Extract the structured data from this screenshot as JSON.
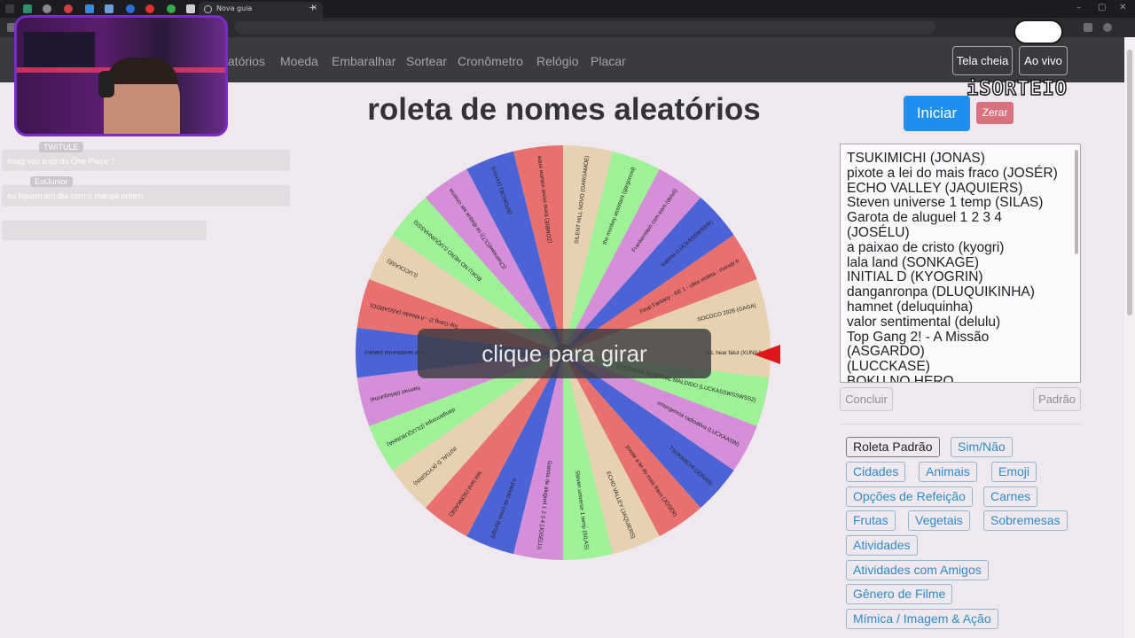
{
  "browser": {
    "tab_title": "Nova guia",
    "new_tab_symbol": "+",
    "close_symbol": "×",
    "window_controls": [
      "–",
      "▢",
      "✕"
    ]
  },
  "nav": {
    "items": [
      "leatórios",
      "Moeda",
      "Embaralhar",
      "Sortear",
      "Cronômetro",
      "Relógio",
      "Placar"
    ],
    "fullscreen_label": "Tela cheia",
    "live_label": "Ao vivo"
  },
  "page": {
    "title": "roleta de nomes aleatórios",
    "start_label": "Iniciar",
    "clear_label": "Zerar",
    "spin_overlay": "clique para girar",
    "done_label": "Concluir",
    "default_label": "Padrão"
  },
  "names_text": "TSUKIMICHI (JONAS)\npixote a lei do mais fraco (JOSÉR)\nECHO VALLEY (JAQUIERS)\nSteven universe 1 temp (SILAS)\nGarota de aluguel 1 2 3 4\n(JOSÉLU)\na paixao de cristo (kyogri)\nlala land (SONKAGE)\nINITIAL D (KYOGRIN)\ndanganronpa (DLUQUIKINHA)\nhamnet (deluquinha)\nvalor sentimental (delulu)\nTop Gang 2! - A Missão\n(ASGARDO)\n(LUCCKASE)\nBOKU NO HERO (LUQUINHASSS)",
  "presets": [
    "Roleta Padrão",
    "Sim/Não",
    "Cidades",
    "Animais",
    "Emoji",
    "Opções de Refeição",
    "Carnes",
    "Frutas",
    "Vegetais",
    "Sobremesas",
    "Atividades",
    "Atividades com Amigos",
    "Gênero de Filme",
    "Mímica / Imagem & Ação"
  ],
  "wheel": {
    "colors": [
      "#e6d2b0",
      "#9ef196",
      "#d48fd8",
      "#4c63d6",
      "#e8706f"
    ],
    "segments": [
      "ALL hear falut (XUNIU)",
      "GOLDMAN HOSPITAL MALDIDO (LUCKASSWSSWSS2)",
      "emergencia radioativa (LUCKAASW)",
      "TSUKIMICHI (JONAS)",
      "pixote a lei do mais fraco (JOSÉR)",
      "ECHO VALLEY (JAQUIERS)",
      "Steven universe 1 temp (SILAS)",
      "Garota de aluguel 1 2 3 4 (JOSÉLU)",
      "a paixao de cristo (kyogri)",
      "lala land (SONKAGE)",
      "INITIAL D (KYOGRIN)",
      "danganronpa (DLUQUIKINHA)",
      "hamnet (deluquinha)",
      "valor sentimental (delulu)",
      "Top Gang 2! - A Missão (ASGARDO)",
      "(LUCCKASE)",
      "BOKU NO HERO (LUQUINHASSS)",
      "(Chainsaw(CLT)) se disque ser cinema",
      "(SPOKCIE) (xxxxxx)",
      "(ZOMBIE) fome move volume entre",
      "SILENT HILL NOVO (GARGAMOE)",
      "the monkey assistant (gargonoid)",
      "Frankenstein com trem (deluli)",
      "supima (LUCKASSWSSW)",
      "Final Fantasy - RE 1 - ultra violeta - monstr fromt - frankenstein (junho)",
      "SOCOCO 2026 (GAGA)"
    ]
  },
  "stream": {
    "chat": [
      {
        "name": "TWITULE",
        "message": "Imag vou o ep do One Piece ?"
      },
      {
        "name": "EstJunior",
        "message": "eu fiquem em dia com o mangá ontem"
      }
    ],
    "logo_text": "iSORTEIO"
  }
}
